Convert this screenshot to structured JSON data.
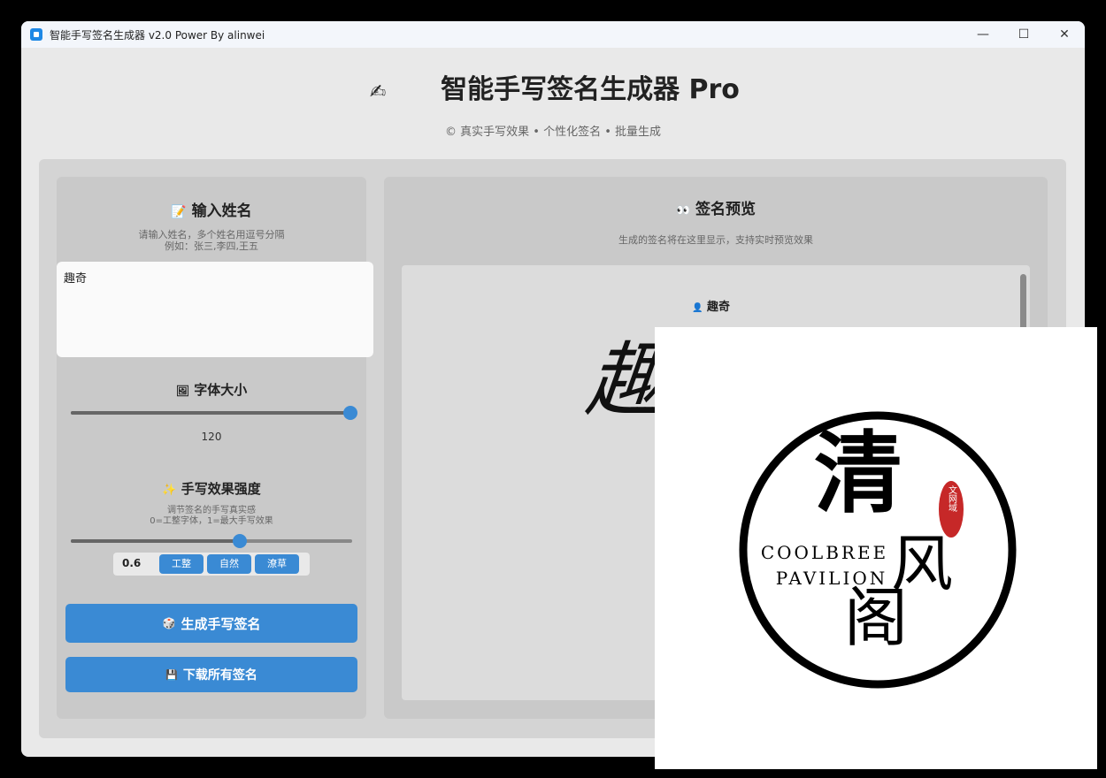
{
  "window": {
    "title": "智能手写签名生成器 v2.0 Power By alinwei",
    "controls": {
      "minimize": "—",
      "maximize": "☐",
      "close": "✕"
    }
  },
  "header": {
    "icon": "✍",
    "title": "智能手写签名生成器 Pro",
    "subtitle": "© 真实手写效果 • 个性化签名 • 批量生成"
  },
  "input_panel": {
    "title": "输入姓名",
    "title_icon": "📝",
    "hint_line1": "请输入姓名，多个姓名用逗号分隔",
    "hint_line2": "例如：张三,李四,王五",
    "value": "趣奇"
  },
  "font_size": {
    "title": "字体大小",
    "title_icon": "🖼",
    "value": "120",
    "level": 1.0
  },
  "strength": {
    "title": "手写效果强度",
    "title_icon": "✨",
    "desc_line1": "调节签名的手写真实感",
    "desc_line2": "0=工整字体，1=最大手写效果",
    "value": "0.6",
    "level": 0.6,
    "presets": [
      "工整",
      "自然",
      "潦草"
    ]
  },
  "buttons": {
    "generate": "生成手写签名",
    "generate_icon": "🎲",
    "download": "下载所有签名",
    "download_icon": "💾"
  },
  "preview": {
    "title": "签名预览",
    "title_icon": "👀",
    "desc": "生成的签名将在这里显示，支持实时预览效果",
    "entries": [
      {
        "name": "趣奇",
        "icon": "👤",
        "signature": "趣"
      }
    ]
  },
  "overlay_logo": {
    "main_char": "清",
    "char2": "风",
    "char3": "阁",
    "english1": "COOLBREE",
    "english2": "PAVILION",
    "seal_text": "文网域",
    "colors": {
      "ring": "#000000",
      "seal": "#c62828"
    }
  }
}
